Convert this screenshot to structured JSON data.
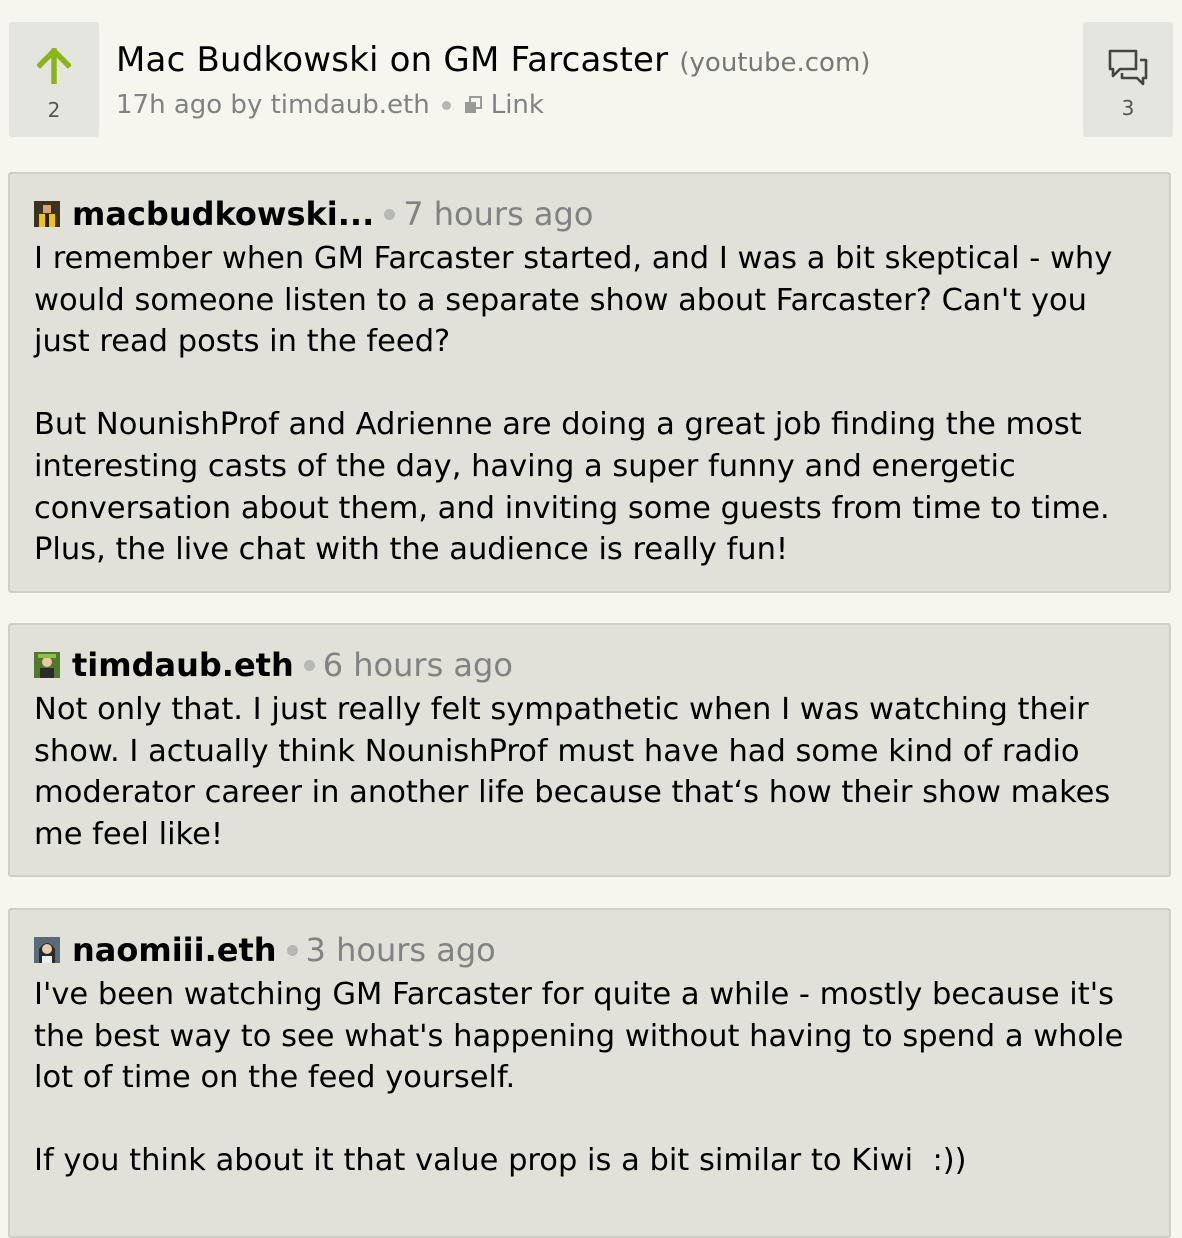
{
  "story": {
    "votes": "2",
    "title": "Mac Budkowski on GM Farcaster",
    "domain": "(youtube.com)",
    "age_by": "17h ago by timdaub.eth",
    "link_label": "Link",
    "comment_count": "3"
  },
  "comments": [
    {
      "author": "macbudkowski...",
      "time": "7 hours ago",
      "paragraphs": [
        "I remember when GM Farcaster started, and I was a bit skeptical - why would someone listen to a separate show about Farcaster? Can't you just read posts in the feed?",
        "But NounishProf and Adrienne are doing a great job finding the most interesting casts of the day, having a super funny and energetic conversation about them, and inviting some guests from time to time. Plus, the live chat with the audience is really fun!"
      ]
    },
    {
      "author": "timdaub.eth",
      "time": "6 hours ago",
      "paragraphs": [
        "Not only that. I just really felt sympathetic when I was watching their show. I actually think NounishProf must have had some kind of radio moderator career in another life because that‘s how their show makes me feel like!"
      ]
    },
    {
      "author": "naomiii.eth",
      "time": "3 hours ago",
      "paragraphs": [
        "I've been watching GM Farcaster for quite a while - mostly because it's the best way to see what's happening without having to spend a whole lot of time on the feed yourself.",
        "If you think about it that value prop is a bit similar to Kiwi  :))"
      ]
    }
  ],
  "colors": {
    "background": "#f6f6ef",
    "upvote_arrow": "#8bb31d",
    "box": "#e5e5df",
    "comment_bg": "#e1e1da",
    "meta_text": "#828282"
  }
}
